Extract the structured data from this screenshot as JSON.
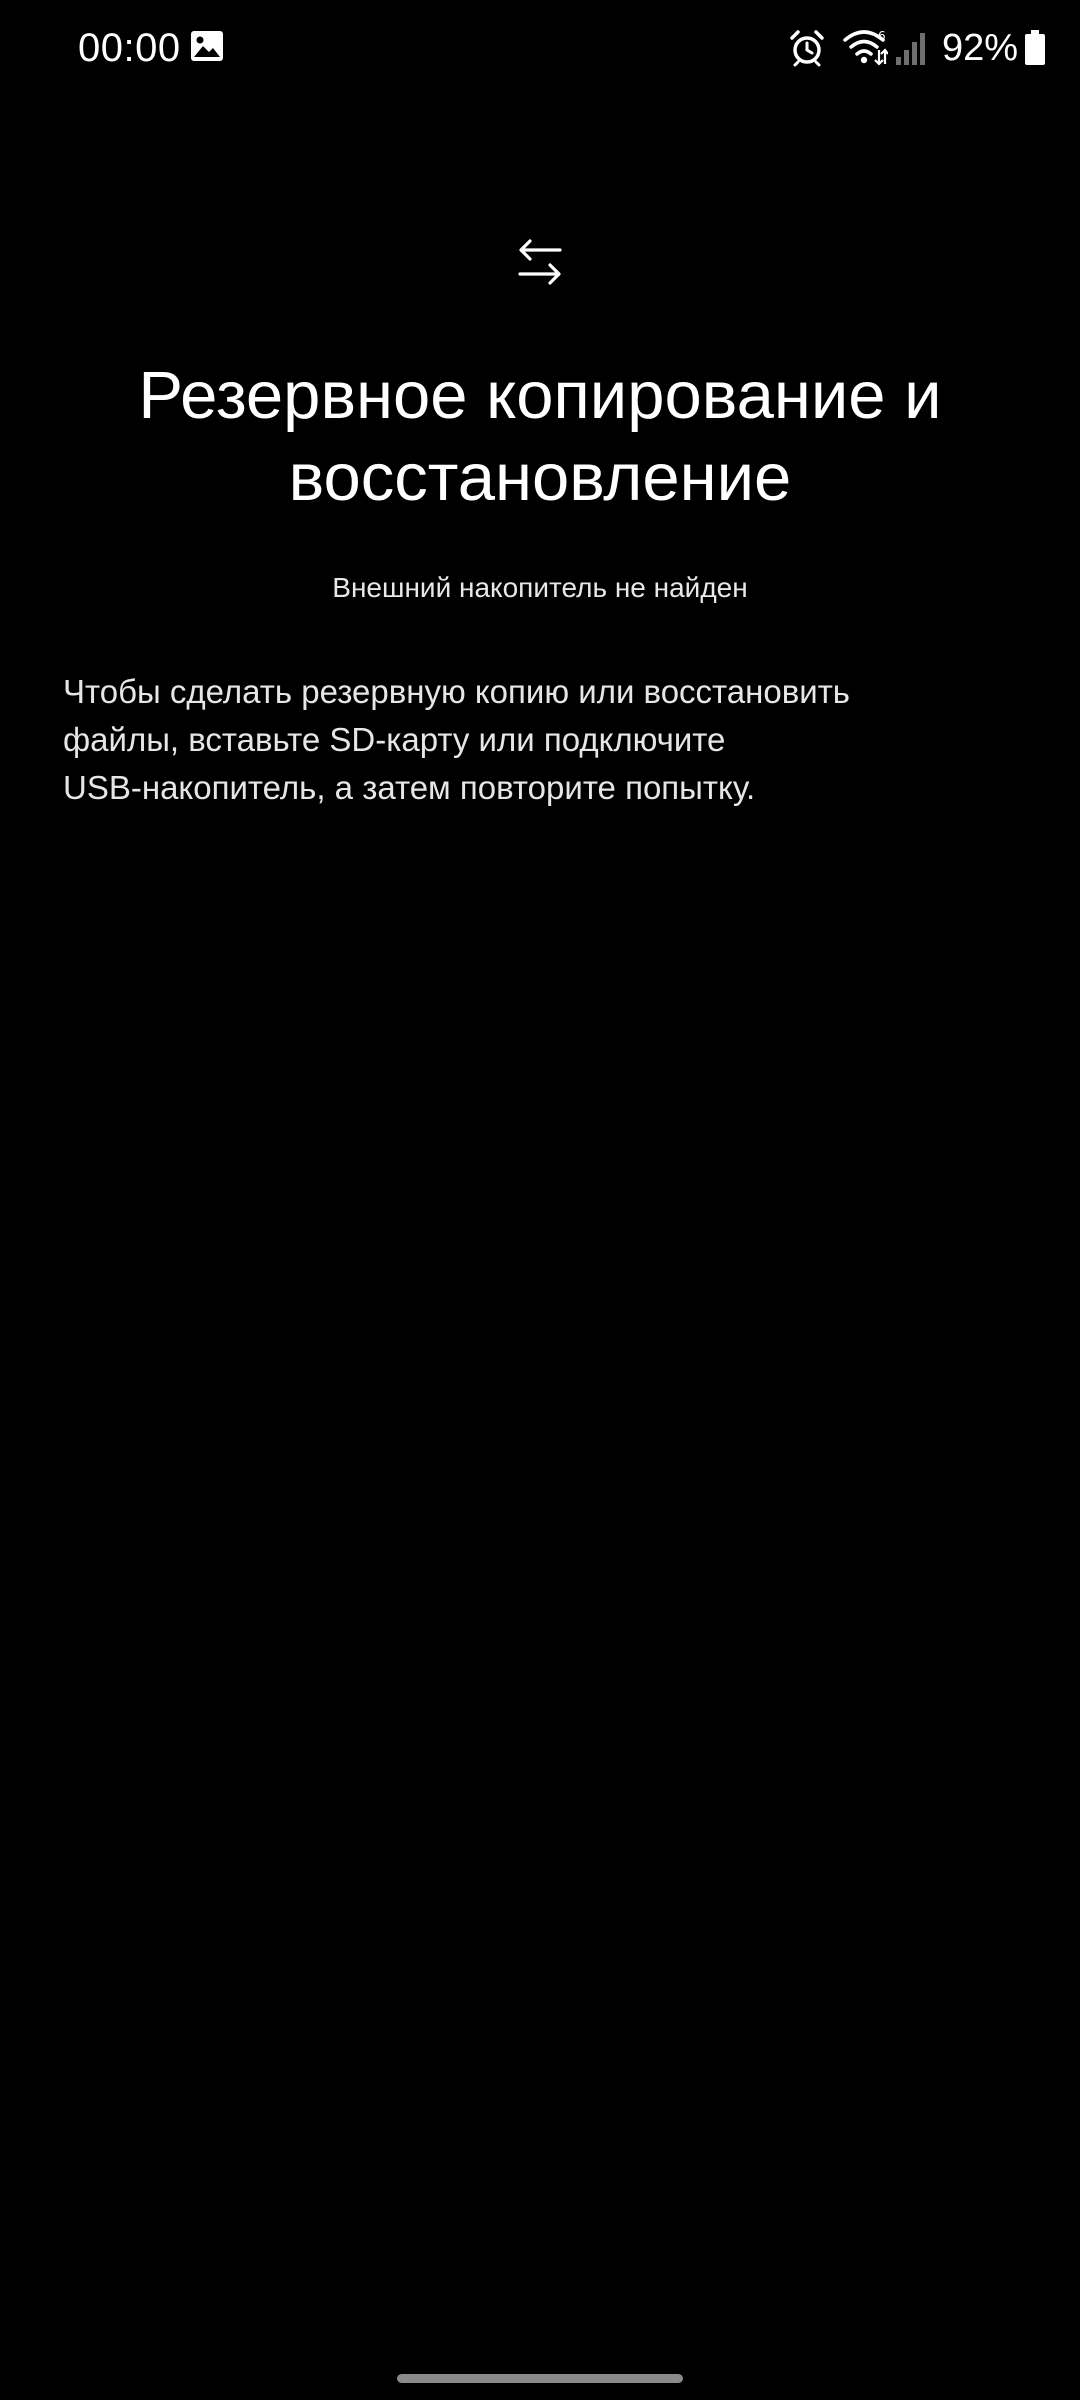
{
  "status_bar": {
    "time": "00:00",
    "battery_percent": "92%",
    "icons": [
      "gallery-icon",
      "alarm-icon",
      "wifi-icon",
      "signal-icon",
      "battery-icon"
    ]
  },
  "main": {
    "icon": "transfer-arrows-icon",
    "title": "Резервное копирование и восстановление",
    "subtitle": "Внешний накопитель не найден",
    "description_lines": [
      "Чтобы сделать резервную копию или восстановить",
      "файлы, вставьте SD-карту или подключите",
      "USB-накопитель, а затем повторите попытку."
    ]
  },
  "colors": {
    "background": "#000000",
    "text": "#ffffff",
    "nav_handle": "#8a8a8a"
  }
}
